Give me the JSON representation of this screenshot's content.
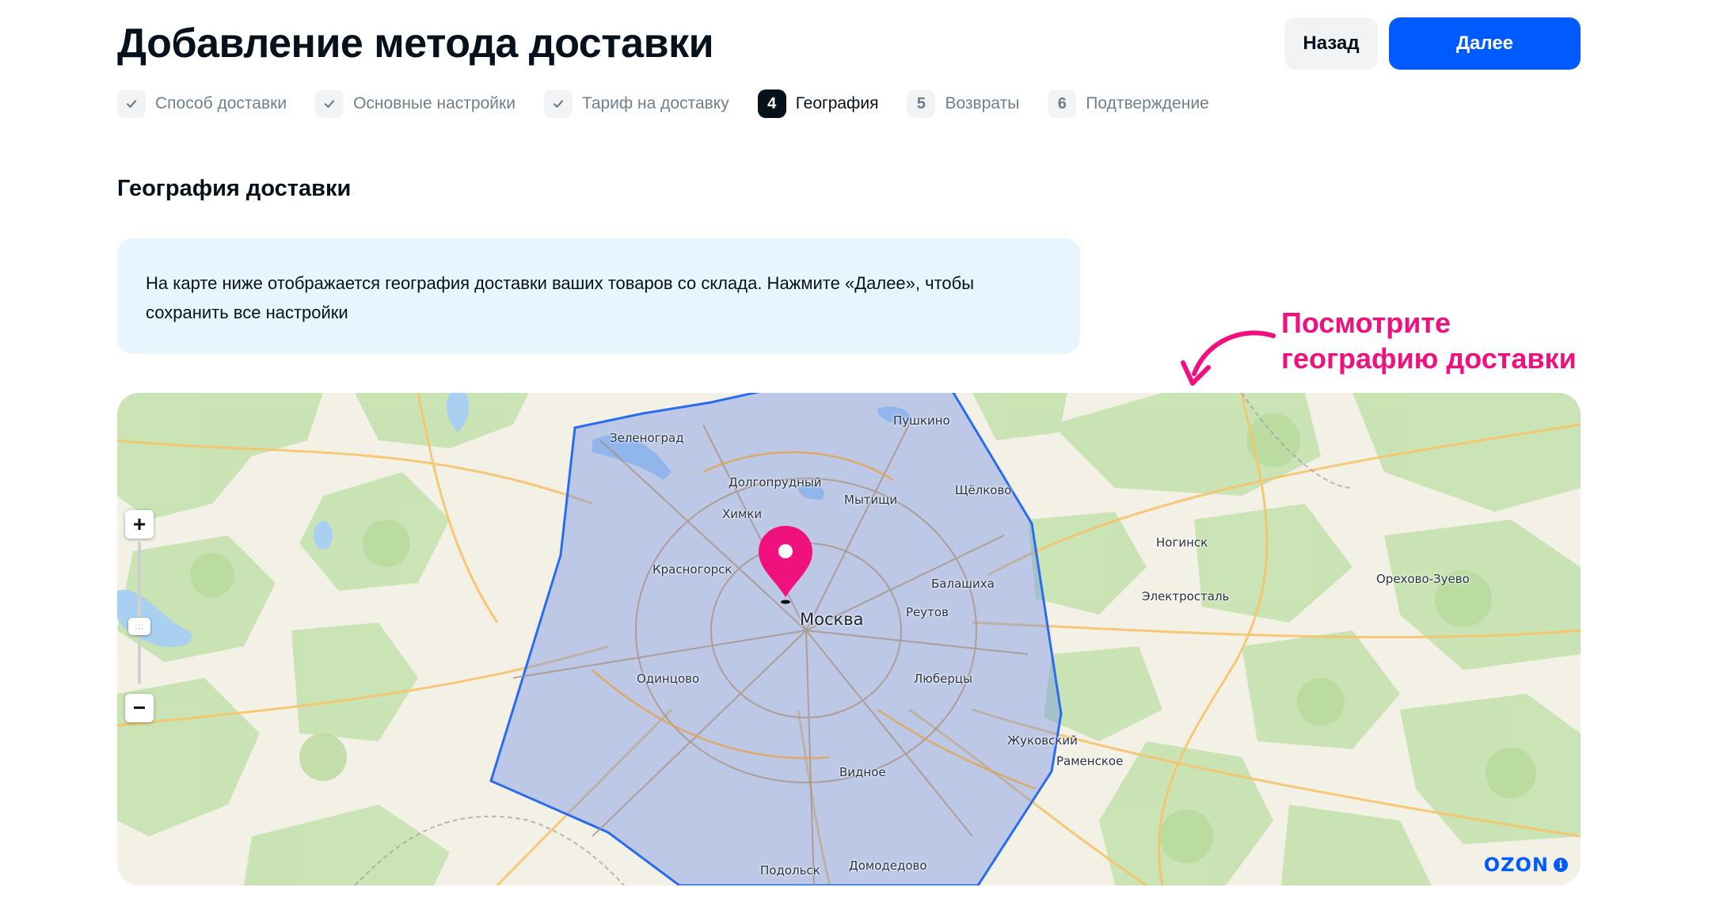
{
  "header": {
    "title": "Добавление метода доставки",
    "back_label": "Назад",
    "next_label": "Далее"
  },
  "steps": [
    {
      "badge": "",
      "label": "Способ доставки",
      "state": "done",
      "icon": "check-icon"
    },
    {
      "badge": "",
      "label": "Основные настройки",
      "state": "done",
      "icon": "check-icon"
    },
    {
      "badge": "",
      "label": "Тариф на доставку",
      "state": "done",
      "icon": "check-icon"
    },
    {
      "badge": "4",
      "label": "География",
      "state": "active"
    },
    {
      "badge": "5",
      "label": "Возвраты",
      "state": "pending"
    },
    {
      "badge": "6",
      "label": "Подтверждение",
      "state": "pending"
    }
  ],
  "section": {
    "title": "География доставки",
    "info": "На карте ниже отображается география доставки ваших товаров со склада. Нажмите «Далее», чтобы сохранить все настройки"
  },
  "hint": {
    "line1": "Посмотрите",
    "line2": "географию доставки",
    "color": "#f1117e"
  },
  "map": {
    "center_city": "Москва",
    "cities": {
      "zelenograd": "Зеленоград",
      "pushkino": "Пушкино",
      "dolgoprudny": "Долгопрудный",
      "mytishchi": "Мытищи",
      "shchelkovo": "Щёлково",
      "khimki": "Химки",
      "noginsk": "Ногинск",
      "krasnogorsk": "Красногорск",
      "balashikha": "Балашиха",
      "orekhovo": "Орехово-Зуево",
      "elektrostal": "Электросталь",
      "reutov": "Реутов",
      "odintsovo": "Одинцово",
      "lyubertsy": "Люберцы",
      "zhukovsky": "Жуковский",
      "ramenskoe": "Раменское",
      "vidnoe": "Видное",
      "podolsk": "Подольск",
      "domodedovo": "Домодедово"
    },
    "zoom_in": "+",
    "zoom_out": "−",
    "logo": "OZON",
    "info_glyph": "i",
    "zone_color": "#2a6cf0",
    "pin_color": "#f1117e"
  }
}
